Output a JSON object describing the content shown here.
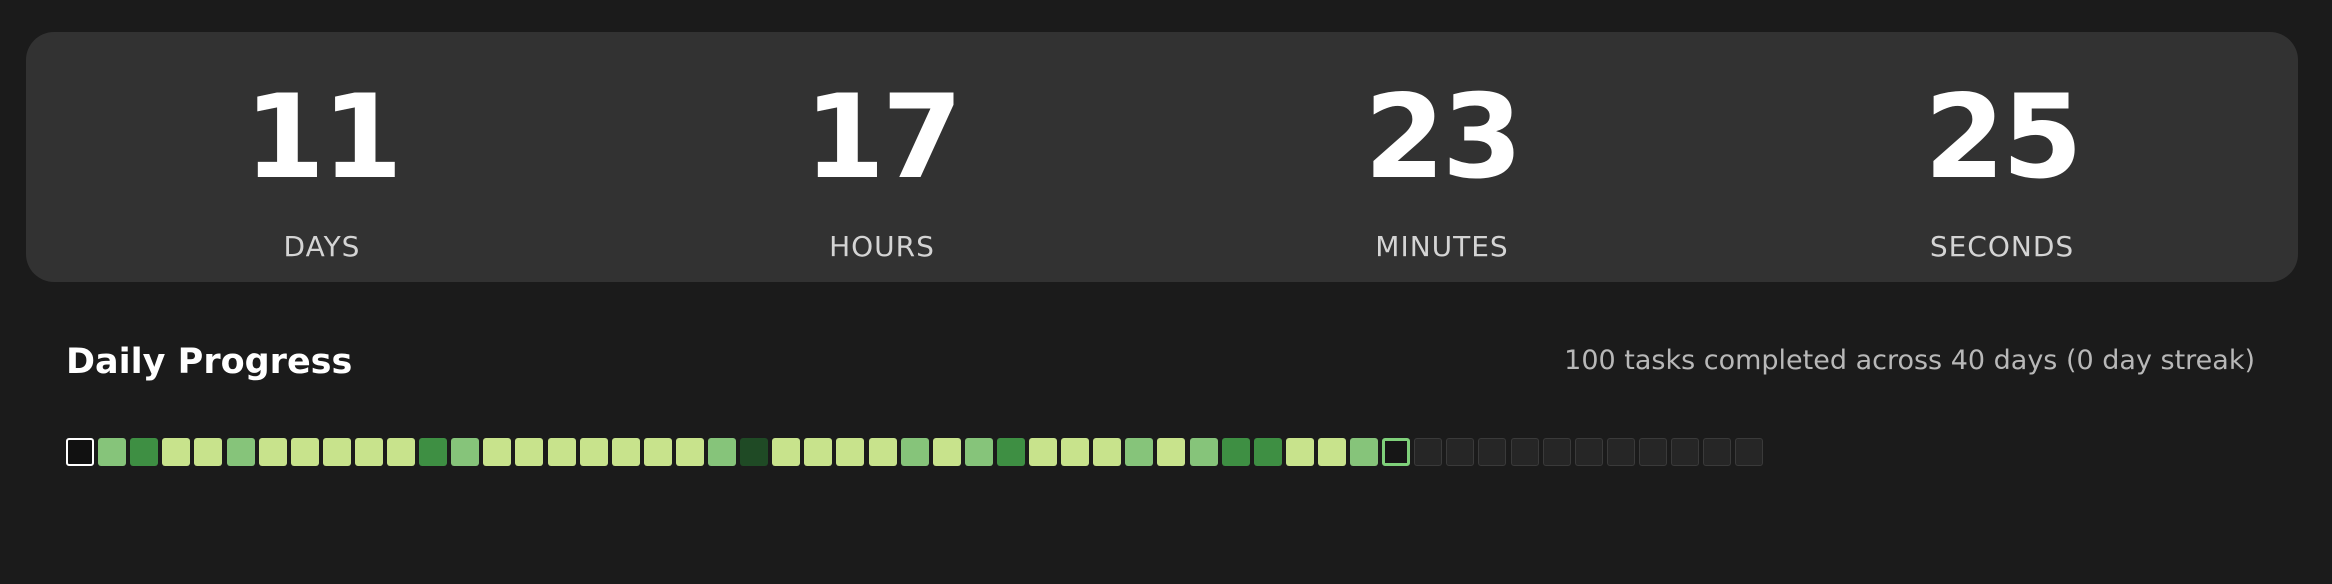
{
  "countdown": {
    "units": [
      {
        "value": "11",
        "label": "DAYS"
      },
      {
        "value": "17",
        "label": "HOURS"
      },
      {
        "value": "23",
        "label": "MINUTES"
      },
      {
        "value": "25",
        "label": "SECONDS"
      }
    ]
  },
  "progress": {
    "title": "Daily Progress",
    "summary": "100 tasks completed across 40 days (0 day streak)",
    "colors": {
      "empty": "#262626",
      "light": "#c8e38c",
      "medium": "#86c47a",
      "dark": "#3e8f43",
      "darkest": "#1f4a25",
      "today_border": "#7fd07a",
      "first_border": "#ffffff"
    },
    "days": [
      "first",
      "medium",
      "dark",
      "light",
      "light",
      "medium",
      "light",
      "light",
      "light",
      "light",
      "light",
      "dark",
      "medium",
      "light",
      "light",
      "light",
      "light",
      "light",
      "light",
      "light",
      "medium",
      "darkest",
      "light",
      "light",
      "light",
      "light",
      "medium",
      "light",
      "medium",
      "dark",
      "light",
      "light",
      "light",
      "medium",
      "light",
      "medium",
      "dark",
      "dark",
      "light",
      "light",
      "medium",
      "today",
      "empty",
      "empty",
      "empty",
      "empty",
      "empty",
      "empty",
      "empty",
      "empty",
      "empty",
      "empty",
      "empty"
    ]
  }
}
